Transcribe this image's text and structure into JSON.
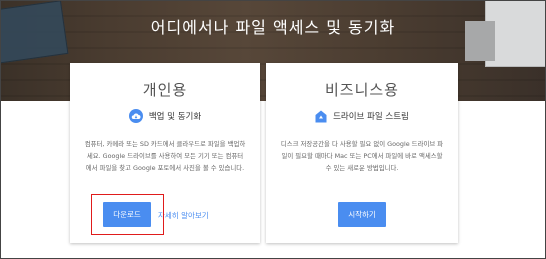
{
  "hero": {
    "title": "어디에서나 파일 액세스 및 동기화"
  },
  "cards": {
    "personal": {
      "title": "개인용",
      "feature": {
        "icon": "cloud-sync-icon",
        "label": "백업 및 동기화"
      },
      "description": "컴퓨터, 카메라 또는 SD 카드에서 클라우드로 파일을 백업하세요. Google 드라이브를 사용하여 모든 기기 또는 컴퓨터에서 파일을 찾고 Google 포토에서 사진을 볼 수 있습니다.",
      "primary_button": "다운로드",
      "link": "자세히 알아보기"
    },
    "business": {
      "title": "비즈니스용",
      "feature": {
        "icon": "drive-stream-icon",
        "label": "드라이브 파일 스트림"
      },
      "description": "디스크 저장공간을 다 사용할 필요 없이 Google 드라이브 파일이 필요할 때마다 Mac 또는 PC에서 파일에 바로 액세스할 수 있는 새로운 방법입니다.",
      "primary_button": "시작하기"
    }
  },
  "colors": {
    "accent": "#4a8df0",
    "highlight": "#e01b1b",
    "hero_bg": "#4a3c30"
  }
}
